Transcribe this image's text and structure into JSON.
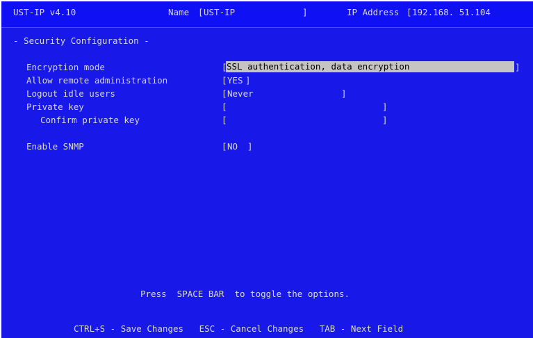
{
  "header": {
    "product": "UST-IP v4.10",
    "name_label": "Name",
    "name_value": "UST-IP",
    "ip_label": "IP Address",
    "ip_value": "192.168. 51.104"
  },
  "section_title": "- Security Configuration -",
  "fields": {
    "encryption_mode": {
      "label": "Encryption mode",
      "value": "SSL authentication, data encryption"
    },
    "allow_remote": {
      "label": "Allow remote administration",
      "value": "YES"
    },
    "logout_idle": {
      "label": "Logout idle users",
      "value": "Never"
    },
    "private_key": {
      "label": "Private key",
      "value": ""
    },
    "confirm_key": {
      "label": "Confirm private key",
      "value": ""
    },
    "enable_snmp": {
      "label": "Enable SNMP",
      "value": "NO"
    }
  },
  "brackets": {
    "open": "[",
    "close": "]"
  },
  "hint": "Press  SPACE BAR  to toggle the options.",
  "footer": "CTRL+S - Save Changes   ESC - Cancel Changes   TAB - Next Field",
  "colors": {
    "background": "#1818e8",
    "header_bg": "#1010f4",
    "text": "#d8d8d8",
    "highlight_bg": "#c4c4c4",
    "highlight_text": "#000000"
  }
}
